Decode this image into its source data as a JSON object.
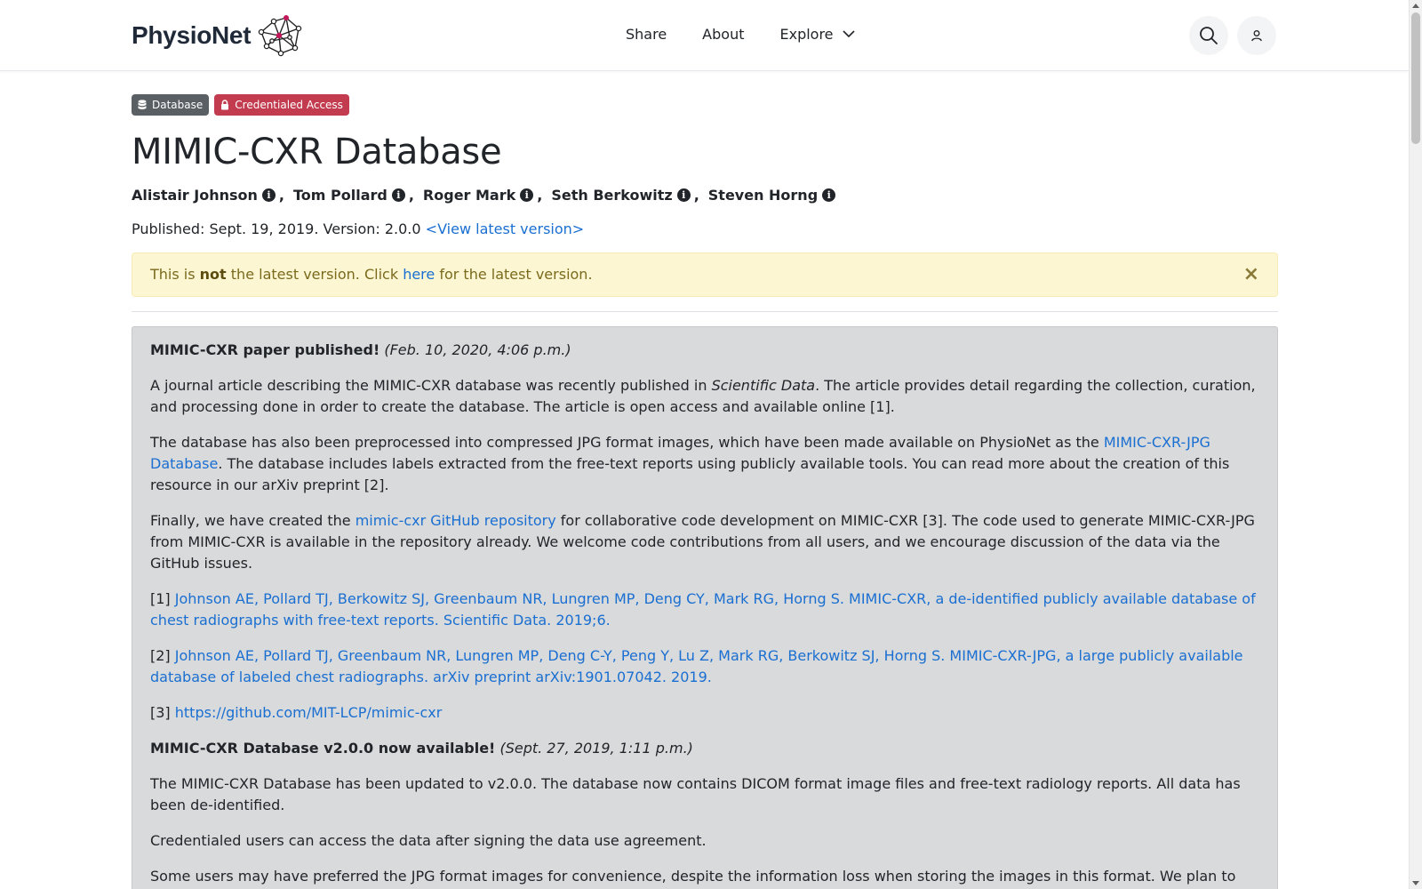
{
  "header": {
    "brand": "PhysioNet",
    "nav": [
      {
        "label": "Share"
      },
      {
        "label": "About"
      },
      {
        "label": "Explore"
      }
    ]
  },
  "badges": {
    "database": "Database",
    "credentialed": "Credentialed Access"
  },
  "page": {
    "title": "MIMIC-CXR Database",
    "authors": [
      "Alistair Johnson",
      "Tom Pollard",
      "Roger Mark",
      "Seth Berkowitz",
      "Steven Horng"
    ],
    "published_prefix": "Published: Sept. 19, 2019. Version: 2.0.0",
    "view_latest": "<View latest version>"
  },
  "alert": {
    "pre": "This is",
    "bold": "not",
    "mid": "the latest version. Click",
    "link": "here",
    "post": "for the latest version.",
    "close": "×"
  },
  "news": {
    "item1": {
      "title": "MIMIC-CXR paper published!",
      "date": "(Feb. 10, 2020, 4:06 p.m.)",
      "p1_pre": "A journal article describing the MIMIC-CXR database was recently published in",
      "p1_em": "Scientific Data",
      "p1_post": ". The article provides detail regarding the collection, curation, and processing done in order to create the database. The article is open access and available online [1].",
      "p2_pre": "The database has also been preprocessed into compressed JPG format images, which have been made available on PhysioNet as the",
      "p2_link": "MIMIC-CXR-JPG Database",
      "p2_post": ". The database includes labels extracted from the free-text reports using publicly available tools. You can read more about the creation of this resource in our arXiv preprint [2].",
      "p3_pre": "Finally, we have created the",
      "p3_link": "mimic-cxr GitHub repository",
      "p3_post": "for collaborative code development on MIMIC-CXR [3]. The code used to generate MIMIC-CXR-JPG from MIMIC-CXR is available in the repository already. We welcome code contributions from all users, and we encourage discussion of the data via the GitHub issues.",
      "ref1_num": "[1]",
      "ref1": "Johnson AE, Pollard TJ, Berkowitz SJ, Greenbaum NR, Lungren MP, Deng CY, Mark RG, Horng S. MIMIC-CXR, a de-identified publicly available database of chest radiographs with free-text reports. Scientific Data. 2019;6.",
      "ref2_num": "[2]",
      "ref2": "Johnson AE, Pollard TJ, Greenbaum NR, Lungren MP, Deng C-Y, Peng Y, Lu Z, Mark RG, Berkowitz SJ, Horng S. MIMIC-CXR-JPG, a large publicly available database of labeled chest radiographs. arXiv preprint arXiv:1901.07042. 2019.",
      "ref3_num": "[3]",
      "ref3": "https://github.com/MIT-LCP/mimic-cxr"
    },
    "item2": {
      "title": "MIMIC-CXR Database v2.0.0 now available!",
      "date": "(Sept. 27, 2019, 1:11 p.m.)",
      "p1": "The MIMIC-CXR Database has been updated to v2.0.0. The database now contains DICOM format image files and free-text radiology reports. All data has been de-identified.",
      "p2": "Credentialed users can access the data after signing the data use agreement.",
      "p3": "Some users may have preferred the JPG format images for convenience, despite the information loss when storing the images in this format. We plan to release a distinct project on PhysioNet which contains the same images as MIMIC-CXR but in JPG format. This distinct project will also contain structured labels derived from"
    }
  }
}
